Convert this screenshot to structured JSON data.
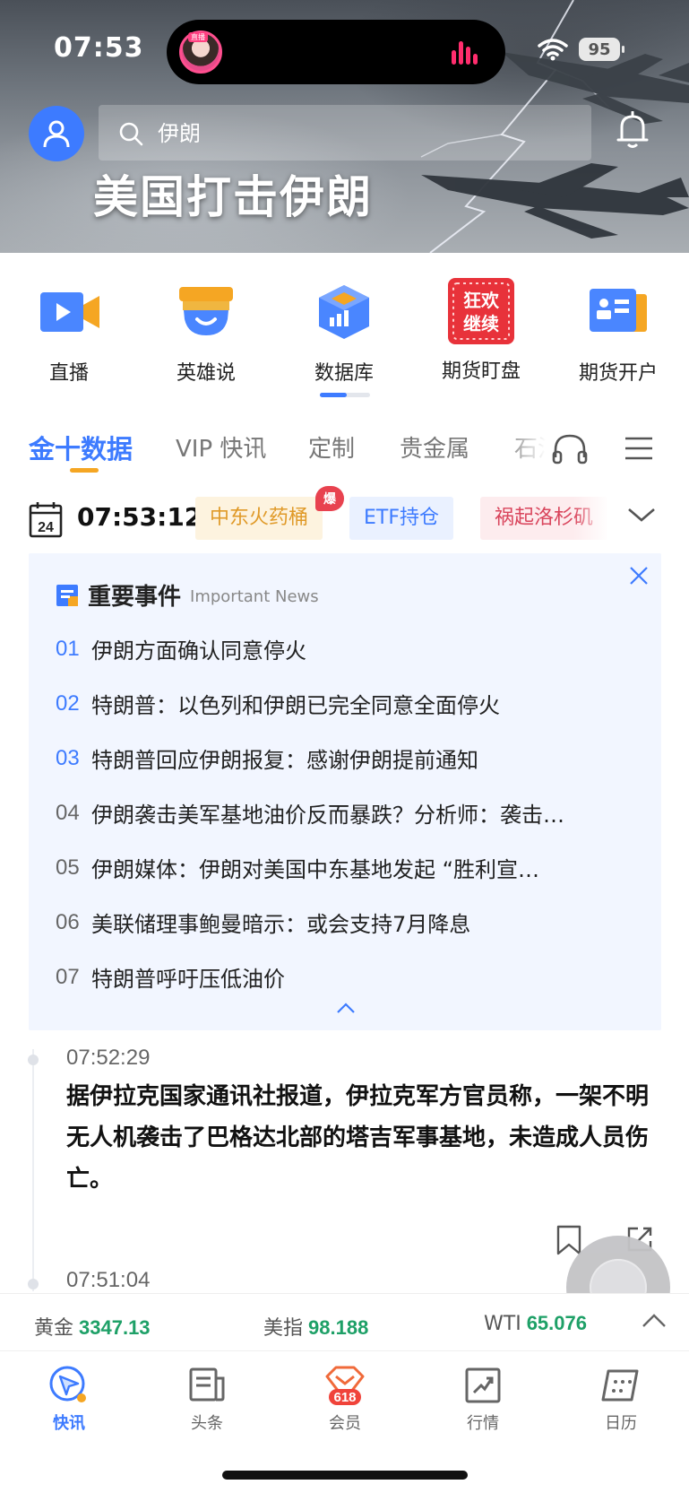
{
  "status_bar": {
    "time": "07:53",
    "battery": "95",
    "live_tag": "直播"
  },
  "header": {
    "search_query": "伊朗",
    "banner_title": "美国打击伊朗"
  },
  "shortcuts": [
    {
      "label": "直播",
      "icon": "video-icon"
    },
    {
      "label": "英雄说",
      "icon": "hero-talk-icon"
    },
    {
      "label": "数据库",
      "icon": "database-icon"
    },
    {
      "label": "期货盯盘",
      "icon": "promo-icon",
      "promo_text": "狂欢继续"
    },
    {
      "label": "期货开户",
      "icon": "account-card-icon"
    }
  ],
  "tabs": {
    "items": [
      "金十数据",
      "VIP 快讯",
      "定制",
      "贵金属",
      "石油"
    ],
    "active_index": 0
  },
  "date_row": {
    "calendar_day": "24",
    "clock": "07:53:12",
    "chips": [
      "中东火药桶",
      "ETF持仓",
      "祸起洛杉矶"
    ],
    "hot_badge": "爆"
  },
  "important_news": {
    "title": "重要事件",
    "subtitle": "Important News",
    "items": [
      {
        "no": "01",
        "text": "伊朗方面确认同意停火"
      },
      {
        "no": "02",
        "text": "特朗普：以色列和伊朗已完全同意全面停火"
      },
      {
        "no": "03",
        "text": "特朗普回应伊朗报复：感谢伊朗提前通知"
      },
      {
        "no": "04",
        "text": "伊朗袭击美军基地油价反而暴跌？分析师：袭击…"
      },
      {
        "no": "05",
        "text": "伊朗媒体：伊朗对美国中东基地发起 “胜利宣…"
      },
      {
        "no": "06",
        "text": "美联储理事鲍曼暗示：或会支持7月降息"
      },
      {
        "no": "07",
        "text": "特朗普呼吁压低油价"
      }
    ]
  },
  "feed": [
    {
      "time": "07:52:29",
      "text": "据伊拉克国家通讯社报道，伊拉克军方官员称，一架不明无人机袭击了巴格达北部的塔吉军事基地，未造成人员伤亡。"
    },
    {
      "time": "07:51:04",
      "text": ""
    }
  ],
  "ticker": [
    {
      "name": "黄金",
      "value": "3347.13"
    },
    {
      "name": "美指",
      "value": "98.188"
    },
    {
      "name": "WTI",
      "value": "65.076"
    }
  ],
  "bottom_nav": [
    {
      "label": "快讯",
      "active": true
    },
    {
      "label": "头条",
      "active": false
    },
    {
      "label": "会员",
      "active": false,
      "badge": "618"
    },
    {
      "label": "行情",
      "active": false
    },
    {
      "label": "日历",
      "active": false
    }
  ],
  "colors": {
    "accent": "#3d7bff",
    "gold": "#f5a623",
    "up_green": "#1ea067",
    "hot_red": "#e8424f"
  }
}
